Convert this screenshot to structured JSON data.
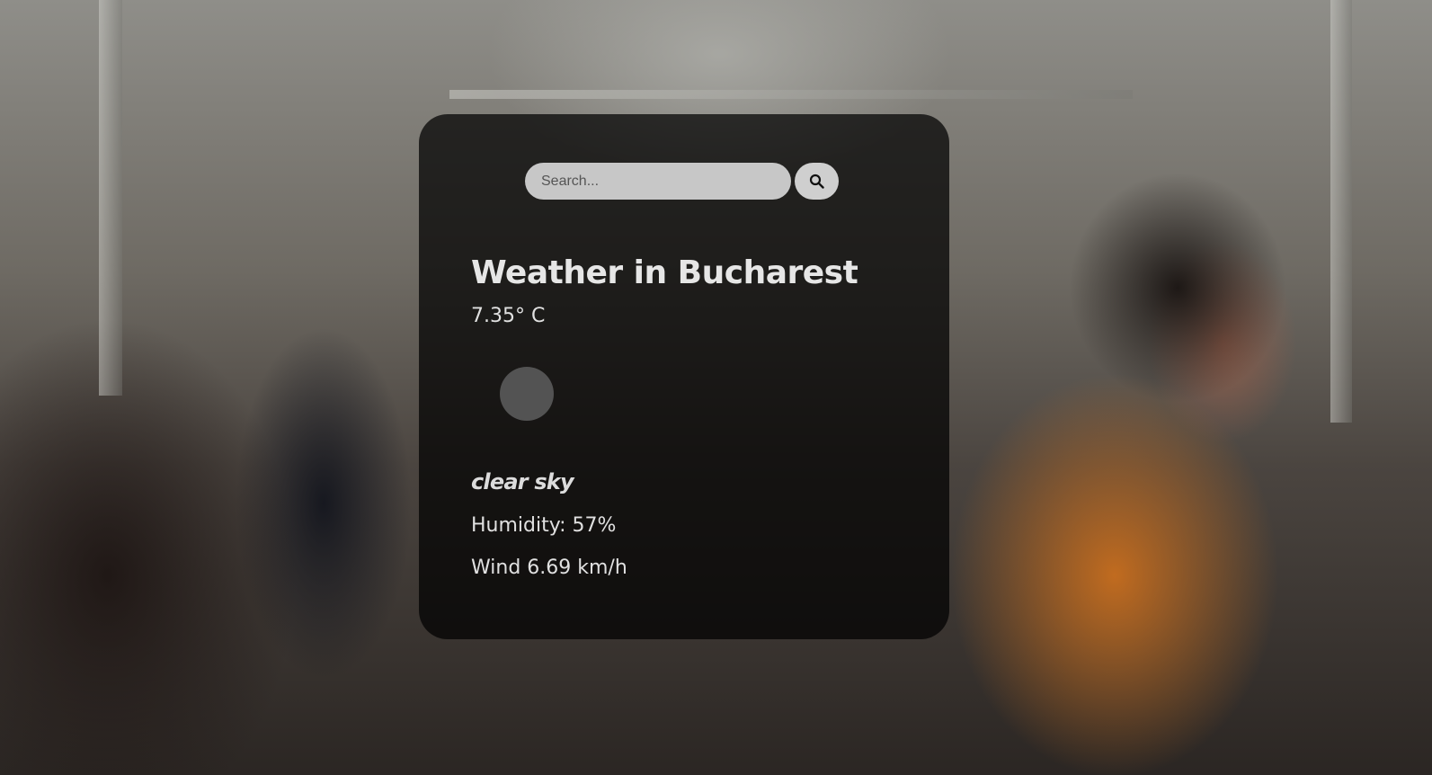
{
  "search": {
    "placeholder": "Search...",
    "icon": "search-icon"
  },
  "weather": {
    "title": "Weather in Bucharest",
    "temperature": "7.35° C",
    "icon": "weather-icon",
    "description": "clear sky",
    "humidity": "Humidity: 57%",
    "wind": "Wind 6.69 km/h"
  },
  "colors": {
    "card_background": "#000000b8",
    "search_input": "#c7c7c7",
    "search_button": "#cfcfcf",
    "text": "#e6e6e6"
  }
}
